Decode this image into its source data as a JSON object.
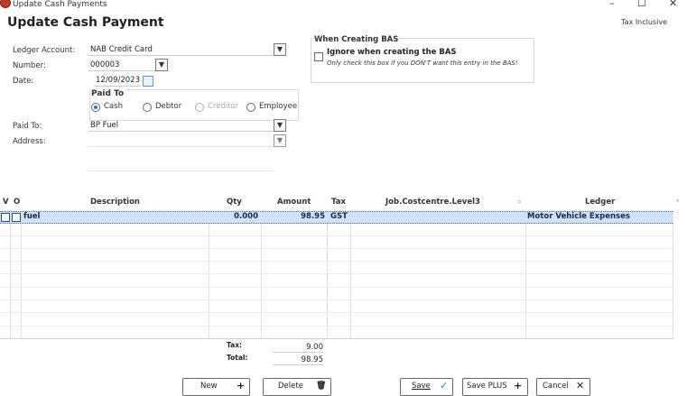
{
  "window": {
    "title": "Update Cash Payments",
    "minimize": "–",
    "maximize": "☐",
    "close": "✕"
  },
  "header": {
    "title": "Update Cash Payment",
    "tax_mode": "Tax Inclusive"
  },
  "form": {
    "ledger_account": {
      "label": "Ledger Account:",
      "value": "NAB Credit Card"
    },
    "number": {
      "label": "Number:",
      "value": "000003"
    },
    "date": {
      "label": "Date:",
      "value": "12/09/2023"
    },
    "paid_to_group": {
      "title": "Paid To",
      "options": [
        {
          "label": "Cash",
          "selected": true,
          "enabled": true
        },
        {
          "label": "Debtor",
          "selected": false,
          "enabled": true
        },
        {
          "label": "Creditor",
          "selected": false,
          "enabled": false
        },
        {
          "label": "Employee",
          "selected": false,
          "enabled": true
        }
      ]
    },
    "paid_to": {
      "label": "Paid To:",
      "value": "BP Fuel"
    },
    "address": {
      "label": "Address:",
      "value": ""
    }
  },
  "bas": {
    "title": "When Creating BAS",
    "checkbox_label": "Ignore when creating the BAS",
    "note": "Only check this box if you DON'T want this entry in the BAS!",
    "checked": false
  },
  "grid": {
    "columns": [
      "V",
      "O",
      "Description",
      "Qty",
      "Amount",
      "Tax",
      "Job.Costcentre.Level3",
      "Ledger"
    ],
    "rows": [
      {
        "description": "fuel",
        "qty": "0.000",
        "amount": "98.95",
        "tax": "GST",
        "job": "",
        "ledger": "Motor Vehicle Expenses"
      }
    ]
  },
  "totals": {
    "tax_label": "Tax:",
    "tax_value": "9.00",
    "total_label": "Total:",
    "total_value": "98.95"
  },
  "buttons": {
    "new": {
      "label": "New",
      "icon": "+"
    },
    "delete": {
      "label": "Delete",
      "icon": "🗑"
    },
    "save": {
      "label": "Save",
      "icon": "✓"
    },
    "save_plus": {
      "label": "Save PLUS",
      "icon": "+"
    },
    "cancel": {
      "label": "Cancel",
      "icon": "✕"
    }
  },
  "colors": {
    "selection": "#cfe2f7",
    "radio_accent": "#2b6fd6",
    "save_check": "#2b7fd6"
  }
}
